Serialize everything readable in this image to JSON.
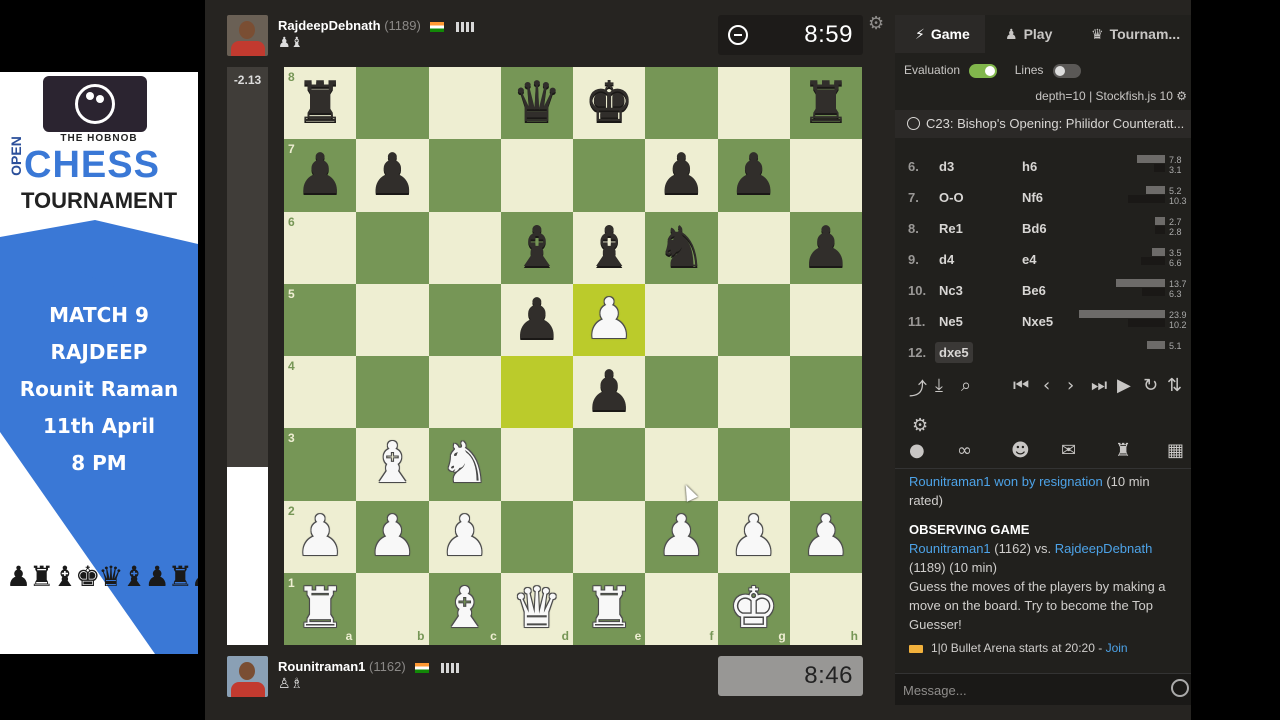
{
  "poster": {
    "logo_text": "THE HOBNOB",
    "open": "OPEN",
    "chess": "CHESS",
    "tournament": "TOURNAMENT",
    "lines": [
      "MATCH 9",
      "RAJDEEP",
      "Rounit Raman",
      "11th April",
      "8 PM"
    ]
  },
  "top_player": {
    "name": "RajdeepDebnath",
    "rating": "(1189)",
    "captured": "♟♝",
    "clock": "8:59"
  },
  "bottom_player": {
    "name": "Rounitraman1",
    "rating": "(1162)",
    "captured": "♙♗",
    "clock": "8:46"
  },
  "eval": {
    "value": "-2.13"
  },
  "board": {
    "ranks": [
      "8",
      "7",
      "6",
      "5",
      "4",
      "3",
      "2",
      "1"
    ],
    "files": [
      "a",
      "b",
      "c",
      "d",
      "e",
      "f",
      "g",
      "h"
    ],
    "position": [
      [
        "r",
        "",
        "",
        "q",
        "k",
        "",
        "",
        "r"
      ],
      [
        "p",
        "p",
        "",
        "",
        "",
        "p",
        "p",
        ""
      ],
      [
        "",
        "",
        "",
        "b",
        "b",
        "n",
        "",
        "p"
      ],
      [
        "",
        "",
        "",
        "p",
        "P",
        "",
        "",
        ""
      ],
      [
        "",
        "",
        "",
        "",
        "p",
        "",
        "",
        ""
      ],
      [
        "",
        "B",
        "N",
        "",
        "",
        "",
        "",
        ""
      ],
      [
        "P",
        "P",
        "P",
        "",
        "",
        "P",
        "P",
        "P"
      ],
      [
        "R",
        "",
        "B",
        "Q",
        "R",
        "",
        "K",
        ""
      ]
    ],
    "highlight": [
      "d4",
      "e5"
    ]
  },
  "panel": {
    "tabs": [
      {
        "icon": "⚡",
        "label": "Game"
      },
      {
        "icon": "♟",
        "label": "Play"
      },
      {
        "icon": "♛",
        "label": "Tournam..."
      }
    ],
    "evaluation_label": "Evaluation",
    "lines_label": "Lines",
    "depth": "depth=10 | Stockfish.js 10",
    "opening": "C23: Bishop's Opening: Philidor Counteratt...",
    "moves": [
      {
        "n": "6.",
        "w": "d3",
        "b": "h6",
        "v1": "7.8",
        "v2": "3.1"
      },
      {
        "n": "7.",
        "w": "O-O",
        "b": "Nf6",
        "v1": "5.2",
        "v2": "10.3"
      },
      {
        "n": "8.",
        "w": "Re1",
        "b": "Bd6",
        "v1": "2.7",
        "v2": "2.8"
      },
      {
        "n": "9.",
        "w": "d4",
        "b": "e4",
        "v1": "3.5",
        "v2": "6.6"
      },
      {
        "n": "10.",
        "w": "Nc3",
        "b": "Be6",
        "v1": "13.7",
        "v2": "6.3"
      },
      {
        "n": "11.",
        "w": "Ne5",
        "b": "Nxe5",
        "v1": "23.9",
        "v2": "10.2"
      },
      {
        "n": "12.",
        "w": "dxe5",
        "b": "",
        "v1": "5.1",
        "v2": ""
      }
    ],
    "feed": {
      "result_player": "Rounitraman1",
      "result_text": "won by resignation",
      "result_tail": "(10 min rated)",
      "observing": "OBSERVING GAME",
      "p1": "Rounitraman1",
      "p1_rating": "(1162) vs.",
      "p2": "RajdeepDebnath",
      "p2_tail": "(1189) (10 min)",
      "guess": "Guess the moves of the players by making a move on the board. Try to become the Top Guesser!",
      "arena": "1|0 Bullet Arena starts at 20:20 -",
      "join": "Join"
    },
    "message_placeholder": "Message..."
  }
}
